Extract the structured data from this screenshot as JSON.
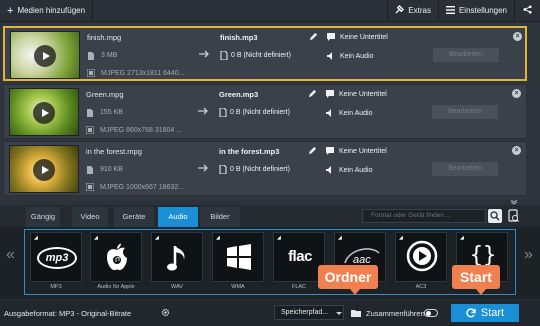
{
  "toolbar": {
    "add_media_label": "Medien hinzufügen",
    "extras_label": "Extras",
    "settings_label": "Einstellungen"
  },
  "files": [
    {
      "name": "finish.mpg",
      "size": "3 MB",
      "info": "MJPEG 2713x1811 6440...",
      "output_name": "finish.mp3",
      "output_size": "0 B (Nicht definiert)",
      "subtitle": "Keine Untertitel",
      "audio": "Kein Audio",
      "edit_label": "Bearbeiten",
      "selected": true
    },
    {
      "name": "Green.mpg",
      "size": "155 KB",
      "info": "MJPEG 860x768 31804 ...",
      "output_name": "Green.mp3",
      "output_size": "0 B (Nicht definiert)",
      "subtitle": "Keine Untertitel",
      "audio": "Kein Audio",
      "edit_label": "Bearbeiten",
      "selected": false
    },
    {
      "name": "in the forest.mpg",
      "size": "910 KB",
      "info": "MJPEG 1000x667 18632...",
      "output_name": "in the forest.mp3",
      "output_size": "0 B (Nicht definiert)",
      "subtitle": "Keine Untertitel",
      "audio": "Kein Audio",
      "edit_label": "Bearbeiten",
      "selected": false
    }
  ],
  "tabs": [
    {
      "label": "Gängig"
    },
    {
      "label": "Video"
    },
    {
      "label": "Geräte"
    },
    {
      "label": "Audio",
      "active": true
    },
    {
      "label": "Bilder"
    }
  ],
  "search": {
    "placeholder": "Format oder Gerät finden..."
  },
  "formats": [
    {
      "label": "MP3",
      "icon": "mp3-icon"
    },
    {
      "label": "Audio für Apple",
      "icon": "apple-icon"
    },
    {
      "label": "WAV",
      "icon": "music-note-icon"
    },
    {
      "label": "WMA",
      "icon": "windows-icon"
    },
    {
      "label": "FLAC",
      "icon": "flac-icon"
    },
    {
      "label": "AAC",
      "icon": "aac-icon"
    },
    {
      "label": "AC3",
      "icon": "ac3-icon"
    },
    {
      "label": "",
      "icon": "braces-icon"
    }
  ],
  "bottom": {
    "output_format": "Ausgabeformat: MP3 - Original-Bitrate",
    "save_path_label": "Speicherpfad...",
    "merge_label": "Zusammenführen",
    "start_label": "Start"
  },
  "callouts": {
    "folder": "Ordner",
    "start": "Start"
  },
  "colors": {
    "accent": "#1a8fd6",
    "selected_border": "#e4b43a",
    "callout": "#f08050"
  }
}
